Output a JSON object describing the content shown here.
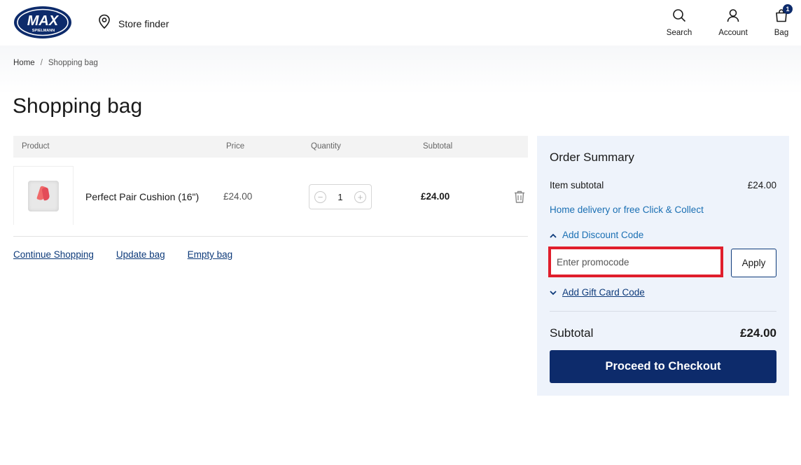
{
  "header": {
    "logo_text": "MAX",
    "logo_subtext": "SPIELMANN",
    "store_finder": "Store finder",
    "search_label": "Search",
    "account_label": "Account",
    "bag_label": "Bag",
    "bag_count": "1"
  },
  "breadcrumb": {
    "home": "Home",
    "separator": "/",
    "current": "Shopping bag"
  },
  "page_title": "Shopping bag",
  "table": {
    "columns": [
      "Product",
      "Price",
      "Quantity",
      "Subtotal"
    ],
    "rows": [
      {
        "name": "Perfect Pair Cushion (16\")",
        "price": "£24.00",
        "quantity": "1",
        "subtotal": "£24.00"
      }
    ]
  },
  "actions": {
    "continue": "Continue Shopping",
    "update": "Update bag",
    "empty": "Empty bag"
  },
  "summary": {
    "title": "Order Summary",
    "item_subtotal_label": "Item subtotal",
    "item_subtotal_value": "£24.00",
    "delivery_link": "Home delivery or free Click & Collect",
    "discount_label": "Add Discount Code",
    "promo_placeholder": "Enter promocode",
    "apply_label": "Apply",
    "gift_label": "Add Gift Card Code",
    "subtotal_label": "Subtotal",
    "subtotal_value": "£24.00",
    "checkout_label": "Proceed to Checkout"
  },
  "colors": {
    "brand_navy": "#0d2b6b",
    "link_blue": "#1a6fb3",
    "highlight_red": "#e01e2c",
    "summary_bg": "#eef3fb"
  }
}
